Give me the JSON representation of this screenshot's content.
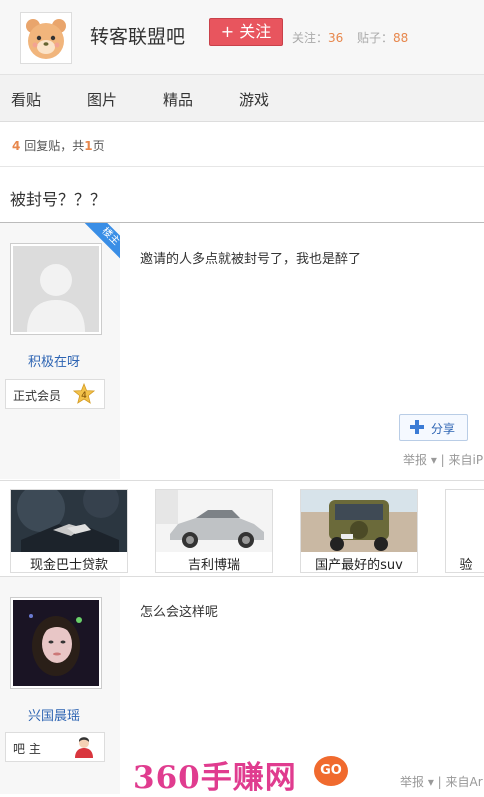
{
  "header": {
    "forum_name": "转客联盟吧",
    "follow_label": "+ 关注",
    "follow_count_label": "关注：",
    "follow_count": "36",
    "post_count_label": "贴子：",
    "post_count": "88"
  },
  "nav": {
    "items": [
      "看贴",
      "图片",
      "精品",
      "游戏"
    ]
  },
  "thread": {
    "reply_count": "4",
    "reply_text": "回复贴，共",
    "page_count": "1",
    "page_text": "页",
    "title": "被封号？？？"
  },
  "posts": [
    {
      "author": "积极在呀",
      "badge": "正式会员",
      "level": "4",
      "owner_tag": "楼主",
      "content": "邀请的人多点就被封号了，我也是醉了",
      "share_label": "分享",
      "meta": "举报 ▾ | 来自iP"
    },
    {
      "author": "兴国晨瑶",
      "badge": "吧 主",
      "content": "怎么会这样呢",
      "meta": "举报 ▾ | 来自Ar"
    }
  ],
  "ads": [
    {
      "caption": "现金巴士贷款"
    },
    {
      "caption": "吉利博瑞"
    },
    {
      "caption": "国产最好的suv"
    },
    {
      "caption": "验"
    }
  ],
  "watermark": {
    "text": "360手赚网",
    "go": "GO"
  },
  "colors": {
    "accent": "#e8555e",
    "link": "#2d64b3",
    "orange": "#e7874c"
  }
}
